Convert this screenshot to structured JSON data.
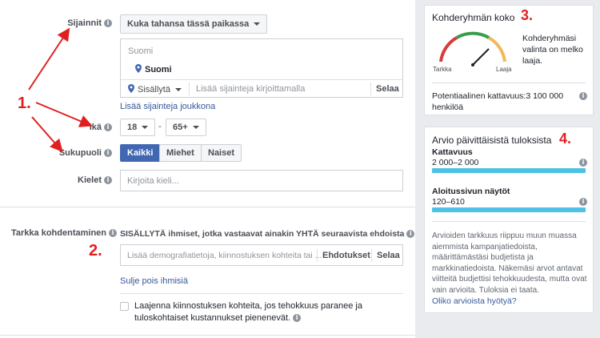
{
  "locations": {
    "label": "Sijainnit",
    "dropdown": "Kuka tahansa tässä paikassa",
    "region_header": "Suomi",
    "selected": "Suomi",
    "include": "Sisällytä",
    "search_placeholder": "Lisää sijainteja kirjoittamalla",
    "browse": "Selaa",
    "bulk_link": "Lisää sijainteja joukkona"
  },
  "age": {
    "label": "Ikä",
    "min": "18",
    "separator": "-",
    "max": "65+"
  },
  "gender": {
    "label": "Sukupuoli",
    "options": [
      "Kaikki",
      "Miehet",
      "Naiset"
    ]
  },
  "languages": {
    "label": "Kielet",
    "placeholder": "Kirjoita kieli..."
  },
  "detailed": {
    "label": "Tarkka kohdentaminen",
    "instruction": "SISÄLLYTÄ ihmiset, jotka vastaavat ainakin YHTÄ seuraavista ehdoista",
    "placeholder": "Lisää demografiatietoja, kiinnostuksen kohteita tai ...",
    "suggestions": "Ehdotukset",
    "browse": "Selaa",
    "exclude_link": "Sulje pois ihmisiä",
    "expand_text": "Laajenna kiinnostuksen kohteita, jos tehokkuus paranee ja tuloskohtaiset kustannukset pienenevät."
  },
  "audience": {
    "title": "Kohderyhmän koko",
    "description": "Kohderyhmäsi valinta on melko laaja.",
    "gauge_left": "Tarkka",
    "gauge_right": "Laaja",
    "reach": "Potentiaalinen kattavuus:3 100 000 henkilöä"
  },
  "estimates": {
    "title": "Arvio päivittäisistä tuloksista",
    "reach_label": "Kattavuus",
    "reach_value": "2 000–2 000",
    "views_label": "Aloitussivun näytöt",
    "views_value": "120–610",
    "note": "Arvioiden tarkkuus riippuu muun muassa aiemmista kampanjatiedoista, määrittämästäsi budjetista ja markkinatiedoista. Näkemäsi arvot antavat viitteitä budjettisi tehokkuudesta, mutta ovat vain arvioita. Tuloksia ei taata.",
    "feedback_link": "Oliko arvioista hyötyä?"
  },
  "annotations": {
    "one": "1.",
    "two": "2.",
    "three": "3.",
    "four": "4."
  },
  "colors": {
    "annotation": "#e02020",
    "accent": "#4267b2",
    "bar": "#4ec2e4"
  }
}
